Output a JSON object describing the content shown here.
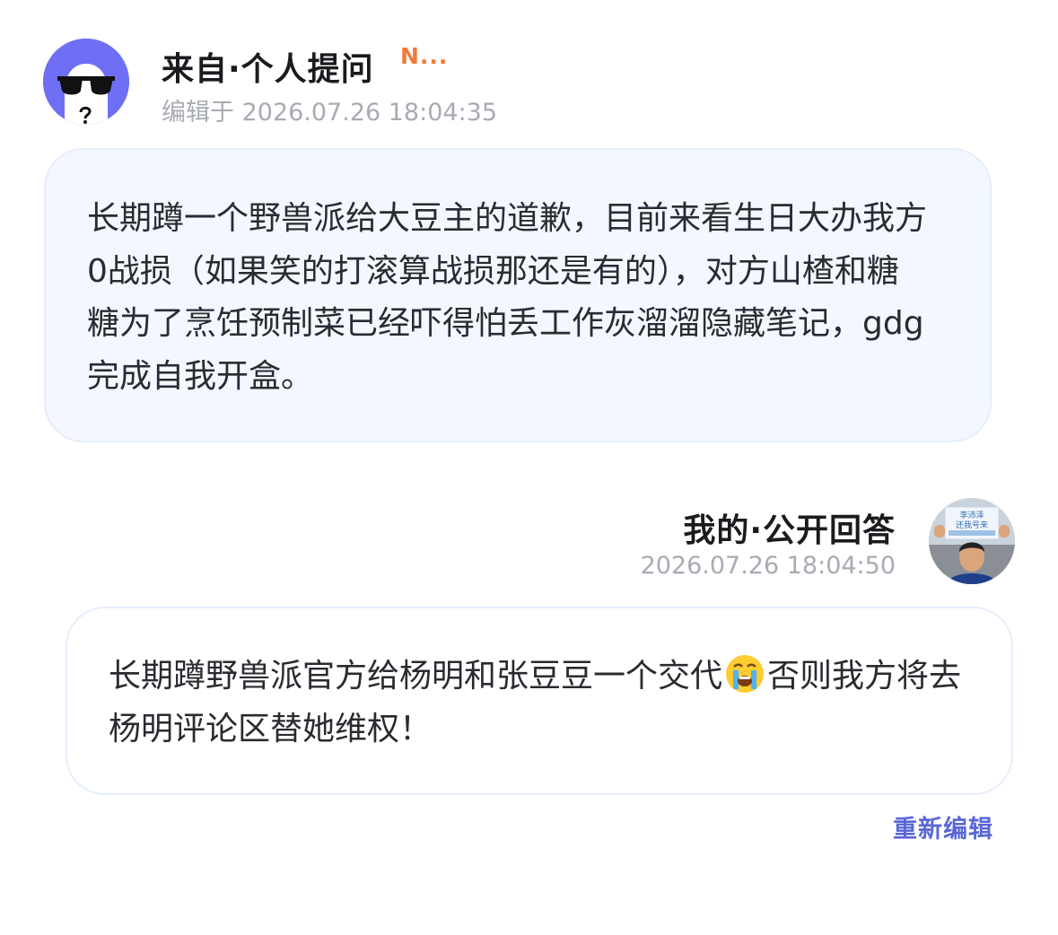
{
  "question": {
    "avatar_icon": "sunglasses-ghost-avatar",
    "title": "来自·个人提问",
    "tag": "N...",
    "edited": "编辑于 2026.07.26 18:04:35",
    "text": "长期蹲一个野兽派给大豆主的道歉，目前来看生日大办我方0战损（如果笑的打滚算战损那还是有的），对方山楂和糖糖为了烹饪预制菜已经吓得怕丢工作灰溜溜隐藏笔记，gdg完成自我开盒。"
  },
  "answer": {
    "title": "我的·公开回答",
    "time": "2026.07.26 18:04:50",
    "avatar_icon": "user-photo-avatar",
    "avatar_sign_line1": "李沛泽",
    "avatar_sign_line2": "还我号来",
    "text_before": "长期蹲野兽派官方给杨明和张豆豆一个交代",
    "emoji": "loudly-crying-face-icon",
    "text_after": "否则我方将去杨明评论区替她维权！",
    "re_edit": "重新编辑"
  },
  "colors": {
    "accent": "#5a67d8",
    "tag": "#f07a3a",
    "question_bubble": "#f3f7fe",
    "avatar_bg": "#6f6ff6"
  }
}
